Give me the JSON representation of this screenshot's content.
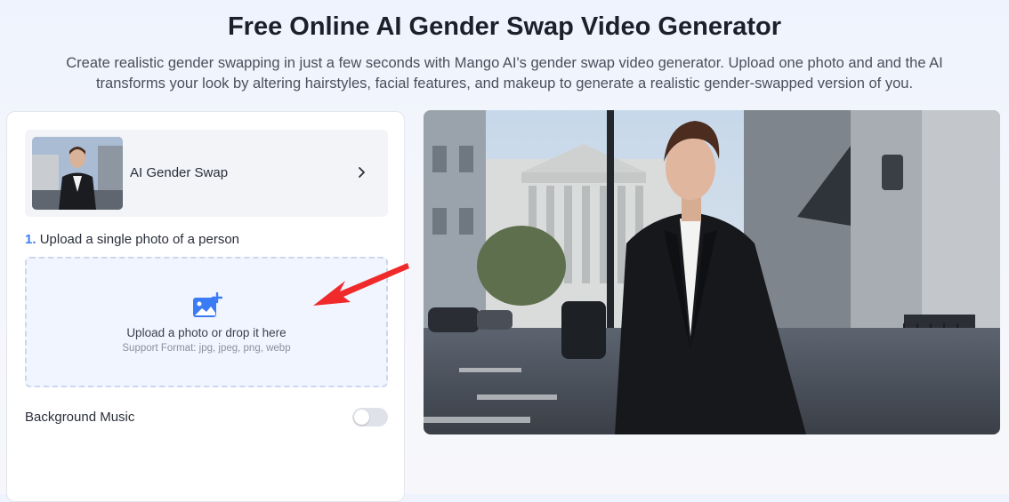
{
  "header": {
    "title": "Free Online AI Gender Swap Video Generator",
    "subtitle": "Create realistic gender swapping in just a few seconds with Mango AI's gender swap video generator. Upload one photo and and the AI transforms your look by altering hairstyles, facial features, and makeup to generate a realistic gender-swapped version of you."
  },
  "template": {
    "label": "AI Gender Swap",
    "thumbnail_icon": "man-in-suit-thumbnail",
    "chevron_icon": "chevron-right-icon"
  },
  "step": {
    "number": "1.",
    "label": "Upload a single photo of a person"
  },
  "upload": {
    "icon": "image-add-icon",
    "title": "Upload a photo or drop it here",
    "formats": "Support Format: jpg, jpeg, png, webp"
  },
  "music": {
    "label": "Background Music",
    "enabled": false
  },
  "preview": {
    "image": "young-man-in-black-suit-city-street"
  },
  "colors": {
    "accent": "#3b7cf4",
    "annotation_arrow": "#f02a2a",
    "upload_bg": "#f1f5ff"
  }
}
